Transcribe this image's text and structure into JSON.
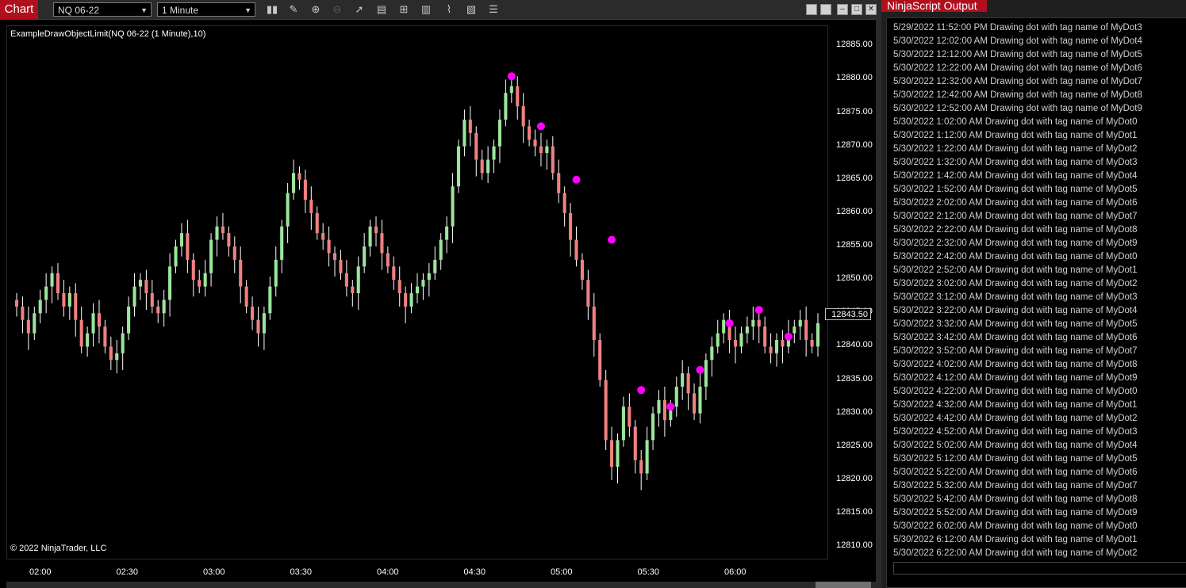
{
  "chart_window": {
    "tab_label": "Chart",
    "instrument": "NQ 06-22",
    "interval": "1 Minute",
    "indicator_label": "ExampleDrawObjectLimit(NQ 06-22 (1 Minute),10)",
    "copyright": "© 2022 NinjaTrader, LLC",
    "current_price": "12843.50",
    "toolbar_icons": [
      "bar-type-icon",
      "pencil-icon",
      "zoom-in-icon",
      "zoom-out-icon",
      "pointer-icon",
      "data-box-icon",
      "indicators-icon",
      "strategies-icon",
      "chart-trader-icon",
      "properties-icon",
      "menu-icon"
    ]
  },
  "chart_data": {
    "type": "candlestick",
    "y_ticks": [
      "12885.00",
      "12880.00",
      "12875.00",
      "12870.00",
      "12865.00",
      "12860.00",
      "12855.00",
      "12850.00",
      "12845.00",
      "12840.00",
      "12835.00",
      "12830.00",
      "12825.00",
      "12820.00",
      "12815.00",
      "12810.00"
    ],
    "ylim": [
      12808,
      12888
    ],
    "x_ticks": [
      "02:00",
      "02:30",
      "03:00",
      "03:30",
      "04:00",
      "04:30",
      "05:00",
      "05:30",
      "06:00"
    ],
    "up_color": "#9be59b",
    "down_color": "#f08080",
    "wick_color": "#ffffff",
    "dot_color": "#ff00ff",
    "closes": [
      12846,
      12844,
      12842,
      12845,
      12847,
      12849,
      12851,
      12848,
      12846,
      12848,
      12844,
      12840,
      12842,
      12845,
      12843,
      12840,
      12838,
      12839,
      12842,
      12846,
      12849,
      12850,
      12848,
      12846,
      12845,
      12847,
      12852,
      12855,
      12857,
      12853,
      12850,
      12849,
      12851,
      12856,
      12858,
      12857,
      12855,
      12853,
      12849,
      12846,
      12844,
      12842,
      12845,
      12849,
      12853,
      12858,
      12863,
      12866,
      12865,
      12862,
      12860,
      12857,
      12856,
      12854,
      12853,
      12851,
      12849,
      12848,
      12852,
      12855,
      12858,
      12857,
      12854,
      12852,
      12850,
      12848,
      12846,
      12848,
      12849,
      12850,
      12851,
      12853,
      12856,
      12858,
      12864,
      12870,
      12874,
      12872,
      12868,
      12866,
      12868,
      12870,
      12874,
      12878,
      12879,
      12876,
      12873,
      12871,
      12870,
      12869,
      12870,
      12866,
      12863,
      12860,
      12856,
      12853,
      12850,
      12846,
      12841,
      12835,
      12826,
      12822,
      12826,
      12831,
      12828,
      12823,
      12821,
      12826,
      12830,
      12832,
      12829,
      12831,
      12834,
      12836,
      12833,
      12830,
      12834,
      12838,
      12840,
      12842,
      12844,
      12841,
      12840,
      12842,
      12843,
      12844,
      12843,
      12840,
      12839,
      12841,
      12840,
      12842,
      12843,
      12844,
      12841,
      12840,
      12843.5
    ],
    "dots": [
      {
        "bar": 84,
        "price": 12880.5
      },
      {
        "bar": 89,
        "price": 12873.0
      },
      {
        "bar": 95,
        "price": 12865.0
      },
      {
        "bar": 101,
        "price": 12856.0
      },
      {
        "bar": 106,
        "price": 12833.5
      },
      {
        "bar": 111,
        "price": 12831.0
      },
      {
        "bar": 116,
        "price": 12836.5
      },
      {
        "bar": 121,
        "price": 12843.5
      },
      {
        "bar": 126,
        "price": 12845.5
      },
      {
        "bar": 131,
        "price": 12841.5
      }
    ]
  },
  "output_window": {
    "tab_label": "NinjaScript Output",
    "lines": [
      "5/29/2022 11:52:00 PM  Drawing dot with tag name of MyDot3",
      "5/30/2022 12:02:00 AM  Drawing dot with tag name of MyDot4",
      "5/30/2022 12:12:00 AM  Drawing dot with tag name of MyDot5",
      "5/30/2022 12:22:00 AM  Drawing dot with tag name of MyDot6",
      "5/30/2022 12:32:00 AM  Drawing dot with tag name of MyDot7",
      "5/30/2022 12:42:00 AM  Drawing dot with tag name of MyDot8",
      "5/30/2022 12:52:00 AM  Drawing dot with tag name of MyDot9",
      "5/30/2022 1:02:00 AM  Drawing dot with tag name of MyDot0",
      "5/30/2022 1:12:00 AM  Drawing dot with tag name of MyDot1",
      "5/30/2022 1:22:00 AM  Drawing dot with tag name of MyDot2",
      "5/30/2022 1:32:00 AM  Drawing dot with tag name of MyDot3",
      "5/30/2022 1:42:00 AM  Drawing dot with tag name of MyDot4",
      "5/30/2022 1:52:00 AM  Drawing dot with tag name of MyDot5",
      "5/30/2022 2:02:00 AM  Drawing dot with tag name of MyDot6",
      "5/30/2022 2:12:00 AM  Drawing dot with tag name of MyDot7",
      "5/30/2022 2:22:00 AM  Drawing dot with tag name of MyDot8",
      "5/30/2022 2:32:00 AM  Drawing dot with tag name of MyDot9",
      "5/30/2022 2:42:00 AM  Drawing dot with tag name of MyDot0",
      "5/30/2022 2:52:00 AM  Drawing dot with tag name of MyDot1",
      "5/30/2022 3:02:00 AM  Drawing dot with tag name of MyDot2",
      "5/30/2022 3:12:00 AM  Drawing dot with tag name of MyDot3",
      "5/30/2022 3:22:00 AM  Drawing dot with tag name of MyDot4",
      "5/30/2022 3:32:00 AM  Drawing dot with tag name of MyDot5",
      "5/30/2022 3:42:00 AM  Drawing dot with tag name of MyDot6",
      "5/30/2022 3:52:00 AM  Drawing dot with tag name of MyDot7",
      "5/30/2022 4:02:00 AM  Drawing dot with tag name of MyDot8",
      "5/30/2022 4:12:00 AM  Drawing dot with tag name of MyDot9",
      "5/30/2022 4:22:00 AM  Drawing dot with tag name of MyDot0",
      "5/30/2022 4:32:00 AM  Drawing dot with tag name of MyDot1",
      "5/30/2022 4:42:00 AM  Drawing dot with tag name of MyDot2",
      "5/30/2022 4:52:00 AM  Drawing dot with tag name of MyDot3",
      "5/30/2022 5:02:00 AM  Drawing dot with tag name of MyDot4",
      "5/30/2022 5:12:00 AM  Drawing dot with tag name of MyDot5",
      "5/30/2022 5:22:00 AM  Drawing dot with tag name of MyDot6",
      "5/30/2022 5:32:00 AM  Drawing dot with tag name of MyDot7",
      "5/30/2022 5:42:00 AM  Drawing dot with tag name of MyDot8",
      "5/30/2022 5:52:00 AM  Drawing dot with tag name of MyDot9",
      "5/30/2022 6:02:00 AM  Drawing dot with tag name of MyDot0",
      "5/30/2022 6:12:00 AM  Drawing dot with tag name of MyDot1",
      "5/30/2022 6:22:00 AM  Drawing dot with tag name of MyDot2"
    ]
  }
}
